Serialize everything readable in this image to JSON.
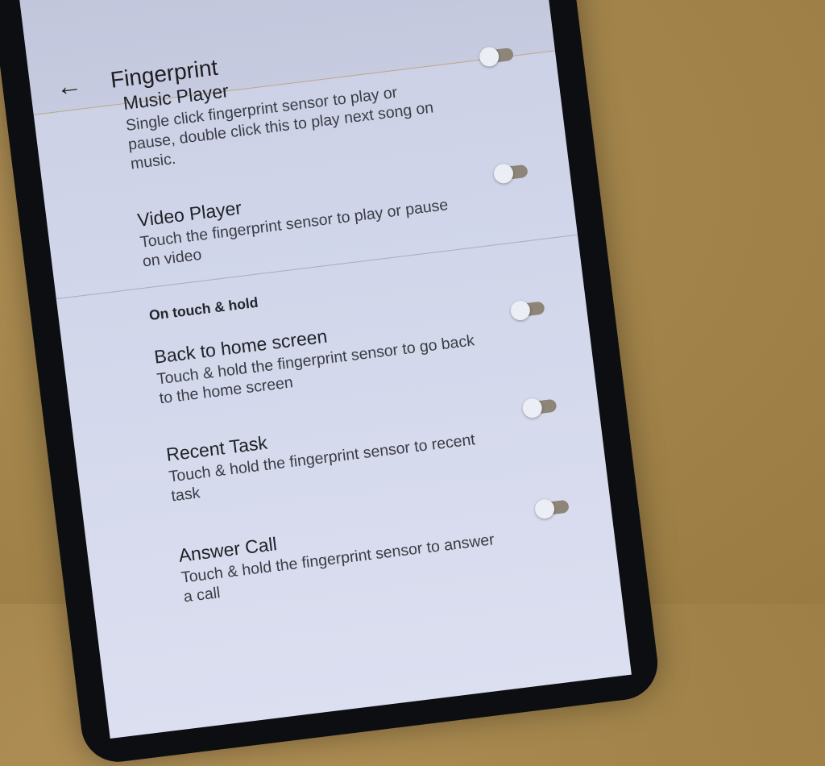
{
  "header": {
    "title": "Fingerprint"
  },
  "items_top": [
    {
      "title": "Music Player",
      "subtitle": "Single click fingerprint sensor to play or pause, double click this to play next song on music."
    },
    {
      "title": "Video Player",
      "subtitle": "Touch the fingerprint sensor to play or pause on video"
    }
  ],
  "section": {
    "label": "On touch & hold"
  },
  "items_hold": [
    {
      "title": "Back to home screen",
      "subtitle": "Touch & hold the fingerprint sensor to go back to the home screen"
    },
    {
      "title": "Recent Task",
      "subtitle": "Touch & hold the fingerprint sensor to recent task"
    },
    {
      "title": "Answer Call",
      "subtitle": "Touch & hold the fingerprint sensor to answer a call"
    }
  ],
  "toggles": {
    "music_player": false,
    "video_player": false,
    "back_to_home": false,
    "recent_task": false,
    "answer_call": false
  },
  "colors": {
    "switch_track": "#8d8577",
    "switch_knob": "#eceef6",
    "screen_bg": "#d1d6ea"
  },
  "icons": {
    "back": "arrow-left-icon"
  }
}
